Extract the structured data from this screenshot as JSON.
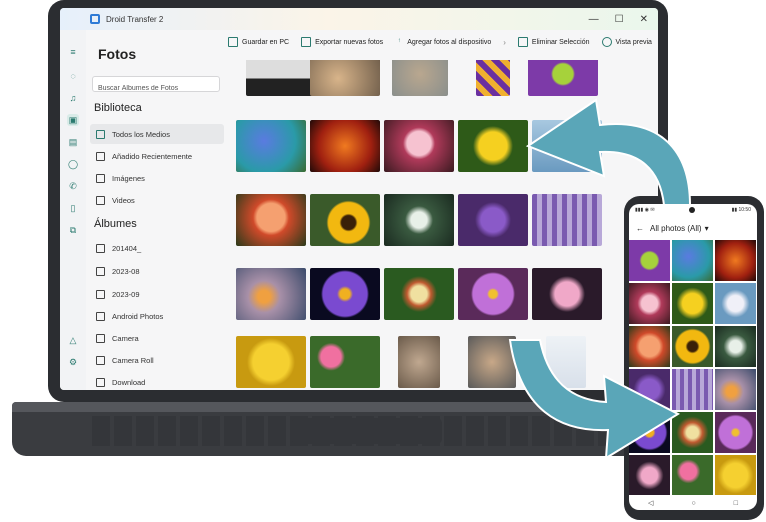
{
  "window": {
    "title": "Droid Transfer 2",
    "controls": [
      "—",
      "☐",
      "✕"
    ]
  },
  "rail_icons": [
    "menu-icon",
    "chat-icon",
    "music-icon",
    "photos-icon",
    "calendar-icon",
    "contacts-icon",
    "phone-icon",
    "file-icon",
    "copy-icon",
    "warning-icon",
    "settings-icon"
  ],
  "page": {
    "title": "Fotos"
  },
  "search": {
    "placeholder": "Buscar Álbumes de Fotos"
  },
  "sidebar": {
    "library_header": "Biblioteca",
    "library": [
      {
        "label": "Todos los Medios",
        "icon": "photo-icon"
      },
      {
        "label": "Añadido Recientemente",
        "icon": "recent-icon"
      },
      {
        "label": "Imágenes",
        "icon": "camera-icon"
      },
      {
        "label": "Videos",
        "icon": "video-icon"
      }
    ],
    "albums_header": "Álbumes",
    "albums": [
      {
        "label": "201404_"
      },
      {
        "label": "2023-08"
      },
      {
        "label": "2023-09"
      },
      {
        "label": "Android Photos"
      },
      {
        "label": "Camera"
      },
      {
        "label": "Camera Roll"
      },
      {
        "label": "Download"
      }
    ]
  },
  "toolbar": {
    "save_pc": "Guardar en PC",
    "export_new": "Exportar nuevas fotos",
    "add_device": "Agregar fotos al dispositivo",
    "more": "›",
    "delete": "Eliminar Selección",
    "preview": "Vista previa"
  },
  "phone": {
    "status_left": "▮▮▮ ◉ ✉",
    "status_right": "▮▮ 10:50",
    "header": "All photos (All)",
    "dropdown_icon": "▾",
    "back_icon": "←",
    "nav": [
      "◁",
      "○",
      "□"
    ]
  },
  "colors": {
    "accent": "#2b7a6f",
    "arrow": "#5aa6b8",
    "rail_dots": [
      "#d63b2f",
      "#2ea24a"
    ]
  }
}
